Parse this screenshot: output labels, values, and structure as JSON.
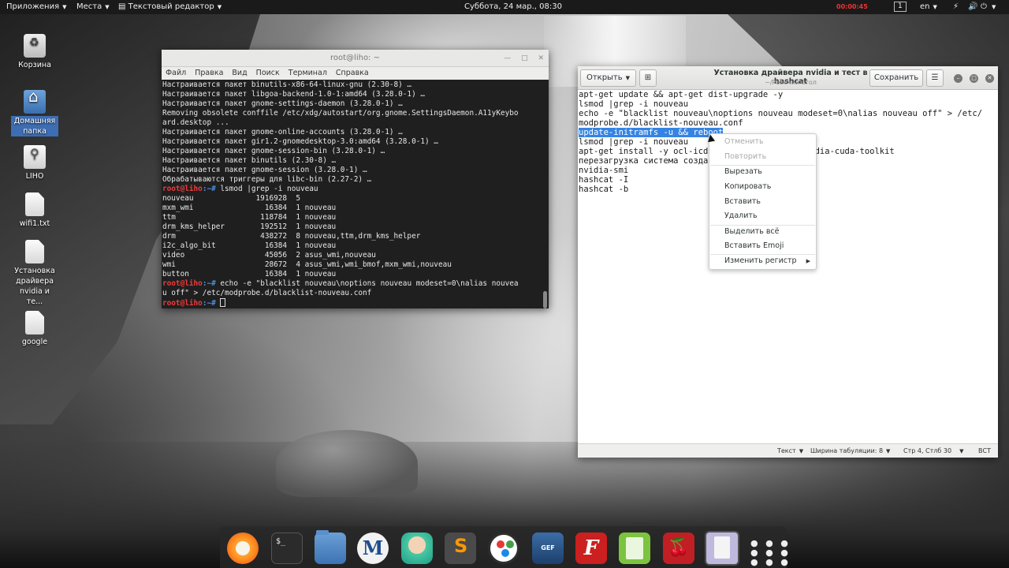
{
  "topbar": {
    "apps": "Приложения",
    "places": "Места",
    "app_name": "Текстовый редактор",
    "clock": "Суббота, 24 мар., 08:30",
    "recording": "00:00:45",
    "workspace": "1",
    "lang": "en"
  },
  "desktop_icons": [
    {
      "label": "Корзина"
    },
    {
      "label": "Домашняя папка"
    },
    {
      "label": "LIHO"
    },
    {
      "label": "wifi1.txt"
    },
    {
      "label": "Установка драйвера nvidia и те..."
    },
    {
      "label": "google"
    }
  ],
  "terminal": {
    "title": "root@liho: ~",
    "menu": [
      "Файл",
      "Правка",
      "Вид",
      "Поиск",
      "Терминал",
      "Справка"
    ],
    "lines": [
      "Настраивается пакет binutils-x86-64-linux-gnu (2.30-8) …",
      "Настраивается пакет libgoa-backend-1.0-1:amd64 (3.28.0-1) …",
      "Настраивается пакет gnome-settings-daemon (3.28.0-1) …",
      "Removing obsolete conffile /etc/xdg/autostart/org.gnome.SettingsDaemon.A11yKeybo",
      "ard.desktop ...",
      "Настраивается пакет gnome-online-accounts (3.28.0-1) …",
      "Настраивается пакет gir1.2-gnomedesktop-3.0:amd64 (3.28.0-1) …",
      "Настраивается пакет gnome-session-bin (3.28.0-1) …",
      "Настраивается пакет binutils (2.30-8) …",
      "Настраивается пакет gnome-session (3.28.0-1) …",
      "Обрабатываются триггеры для libc-bin (2.27-2) …"
    ],
    "prompt_user": "root@liho",
    "prompt_path": ":~#",
    "cmd1": " lsmod |grep -i nouveau",
    "lsmod_lines": [
      "nouveau              1916928  5",
      "mxm_wmi                16384  1 nouveau",
      "ttm                   118784  1 nouveau",
      "drm_kms_helper        192512  1 nouveau",
      "drm                   438272  8 nouveau,ttm,drm_kms_helper",
      "i2c_algo_bit           16384  1 nouveau",
      "video                  45056  2 asus_wmi,nouveau",
      "wmi                    28672  4 asus_wmi,wmi_bmof,mxm_wmi,nouveau",
      "button                 16384  1 nouveau"
    ],
    "cmd2a": " echo -e \"blacklist nouveau\\noptions nouveau modeset=0\\nalias nouvea",
    "cmd2b": "u off\" > /etc/modprobe.d/blacklist-nouveau.conf"
  },
  "editor": {
    "open_label": "Открыть",
    "title": "Установка драйвера nvidia и тест в hashcat",
    "subtitle": "~/Рабочий стол",
    "save_label": "Сохранить",
    "lines": [
      "apt-get update && apt-get dist-upgrade -y",
      "lsmod |grep -i nouveau",
      "echo -e \"blacklist nouveau\\noptions nouveau modeset=0\\nalias nouveau off\" > /etc/",
      "modprobe.d/blacklist-nouveau.conf"
    ],
    "selected_line": "update-initramfs -u && reboot",
    "lines_after": [
      "lsmod |grep -i nouveau",
      "apt-get install -y ocl-icd-l",
      "перезагрузка система создаст",
      "nvidia-smi",
      "hashcat -I",
      "hashcat -b"
    ],
    "line_tail": "r nvidia-cuda-toolkit",
    "status": {
      "syntax": "Текст",
      "tab_width": "Ширина табуляции: 8",
      "position": "Стр 4, Стлб 30",
      "insert_mode": "ВСТ"
    }
  },
  "context_menu": {
    "items": [
      {
        "label": "Отменить",
        "enabled": false
      },
      {
        "label": "Повторить",
        "enabled": false
      },
      {
        "label": "Вырезать",
        "enabled": true
      },
      {
        "label": "Копировать",
        "enabled": true
      },
      {
        "label": "Вставить",
        "enabled": true
      },
      {
        "label": "Удалить",
        "enabled": true
      },
      {
        "label": "Выделить всё",
        "enabled": true
      },
      {
        "label": "Вставить Emoji",
        "enabled": true
      },
      {
        "label": "Изменить регистр",
        "enabled": true,
        "submenu": true
      }
    ]
  },
  "dock": {
    "terminal_glyph": "$_",
    "maltego_glyph": "M",
    "gef_glyph": "GEF",
    "filezilla_glyph": "F",
    "cherry_glyph": "🍒",
    "apps_glyph": "● ● ●\n● ● ●\n● ● ●"
  }
}
